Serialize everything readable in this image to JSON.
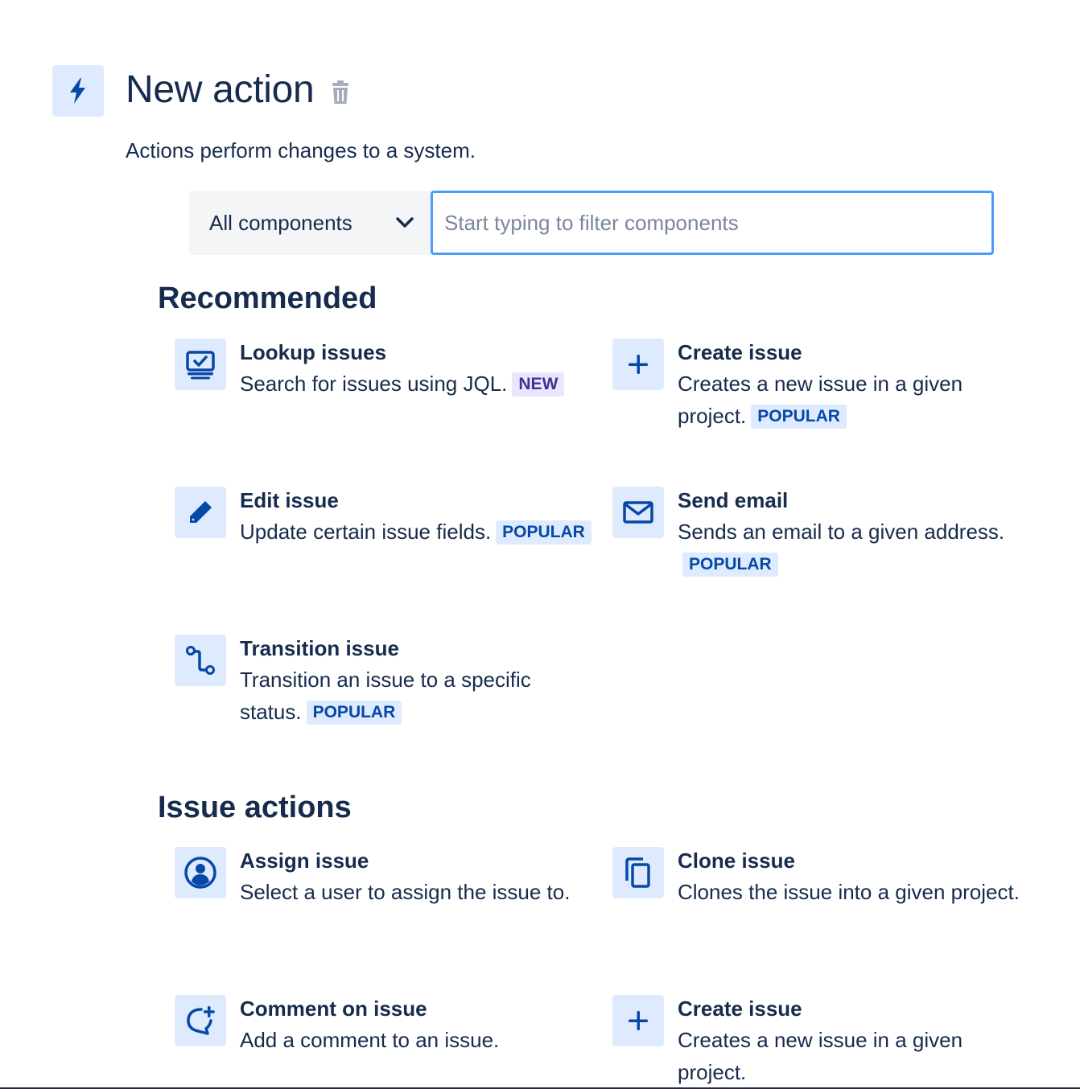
{
  "header": {
    "icon": "lightning-icon",
    "title": "New action",
    "delete_icon": "trash-icon",
    "subtitle": "Actions perform changes to a system."
  },
  "filter": {
    "select_value": "All components",
    "placeholder": "Start typing to filter components"
  },
  "sections": [
    {
      "title": "Recommended",
      "items": [
        {
          "icon": "lookup-icon",
          "name": "Lookup issues",
          "desc": "Search for issues using JQL.",
          "badge": "NEW"
        },
        {
          "icon": "plus-icon",
          "name": "Create issue",
          "desc": "Creates a new issue in a given project.",
          "badge": "POPULAR"
        },
        {
          "icon": "pencil-icon",
          "name": "Edit issue",
          "desc": "Update certain issue fields.",
          "badge": "POPULAR"
        },
        {
          "icon": "email-icon",
          "name": "Send email",
          "desc": "Sends an email to a given address.",
          "badge": "POPULAR"
        },
        {
          "icon": "transition-icon",
          "name": "Transition issue",
          "desc": "Transition an issue to a specific status.",
          "badge": "POPULAR"
        }
      ]
    },
    {
      "title": "Issue actions",
      "items": [
        {
          "icon": "user-icon",
          "name": "Assign issue",
          "desc": "Select a user to assign the issue to."
        },
        {
          "icon": "clone-icon",
          "name": "Clone issue",
          "desc": "Clones the issue into a given project."
        },
        {
          "icon": "comment-add-icon",
          "name": "Comment on issue",
          "desc": "Add a comment to an issue."
        },
        {
          "icon": "plus-icon",
          "name": "Create issue",
          "desc": "Creates a new issue in a given project."
        }
      ]
    }
  ],
  "colors": {
    "text": "#172b4d",
    "icon_bg": "#deebff",
    "icon_fg": "#0747a6",
    "focus_border": "#4c9aff",
    "popular_bg": "#deebff",
    "popular_fg": "#0747a6",
    "new_bg": "#eae6ff",
    "new_fg": "#403294"
  }
}
